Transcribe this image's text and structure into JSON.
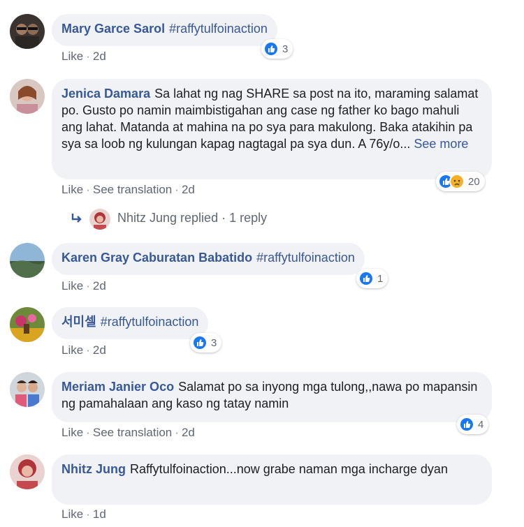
{
  "colors": {
    "link": "#385898",
    "meta": "#606770",
    "bubble": "#f0f2f5",
    "like": "#1877f2",
    "sad": "#f7b125"
  },
  "comments": [
    {
      "author": "Mary Garce Sarol",
      "text": "",
      "hashtag": "#raffytulfoinaction",
      "actions": [
        "Like",
        "2d"
      ],
      "reaction_count": "3"
    },
    {
      "author": "Jenica Damara",
      "text": "Sa lahat ng nag SHARE sa post na ito, maraming salamat po. Gusto po namin maimbistigahan ang case ng father ko bago mahuli ang lahat. Matanda at mahina na po sya para makulong. Baka atakihin pa sya sa loob ng kulungan kapag nagtagal pa sya dun. A 76y/o...",
      "see_more": "See more",
      "actions": [
        "Like",
        "See translation",
        "2d"
      ],
      "reaction_count": "20"
    },
    {
      "author": "Karen Gray Caburatan Babatido",
      "text": "",
      "hashtag": "#raffytulfoinaction",
      "actions": [
        "Like",
        "2d"
      ],
      "reaction_count": "1"
    },
    {
      "author": "서미셀",
      "text": "",
      "hashtag": "#raffytulfoinaction",
      "actions": [
        "Like",
        "2d"
      ],
      "reaction_count": "3"
    },
    {
      "author": "Meriam Janier Oco",
      "text": "Salamat po sa inyong mga tulong,,nawa po mapansin ng pamahalaan ang kaso ng tatay namin",
      "actions": [
        "Like",
        "See translation",
        "2d"
      ],
      "reaction_count": "4"
    },
    {
      "author": "Nhitz Jung",
      "text": "Raffytulfoinaction...now grabe naman mga incharge dyan",
      "actions": [
        "Like",
        "1d"
      ]
    }
  ],
  "reply": {
    "name_text": "Nhitz Jung replied",
    "sep": "·",
    "count_text": "1 reply"
  },
  "sep": "·"
}
